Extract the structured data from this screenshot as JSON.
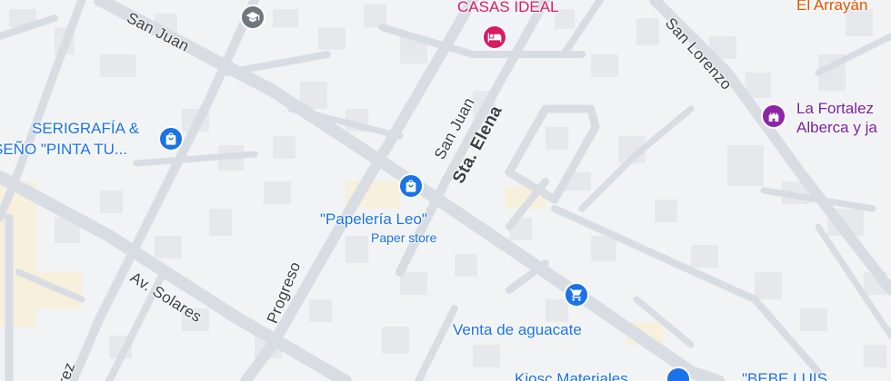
{
  "map": {
    "colors": {
      "background": "#f1f3f4",
      "road": "#d7dde3",
      "road_edge": "#c8d0d8",
      "building": "#e6e8eb",
      "sand": "#f7f0dc",
      "shopping": "#1a73e8",
      "lodging": "#d81b60",
      "landmark": "#7b1fa2",
      "education": "#5f6368"
    },
    "streets": [
      {
        "name": "San Juan"
      },
      {
        "name": "San Juan"
      },
      {
        "name": "Sta. Elena"
      },
      {
        "name": "San Lorenzo"
      },
      {
        "name": "Progreso"
      },
      {
        "name": "Av. Solares"
      },
      {
        "name": "rez"
      }
    ],
    "pois": {
      "casas_ideal": {
        "name": "CASAS IDEAL",
        "icon": "bed-icon"
      },
      "el_arrayan": {
        "name": "El Arrayán"
      },
      "fortaleza": {
        "name_line1": "La Fortalez",
        "name_line2": "Alberca y ja",
        "icon": "castle-icon"
      },
      "serigrafia": {
        "name_line1": "SERIGRAFÍA &",
        "name_line2": "SEÑO \"PINTA TU...",
        "icon": "shopping-bag-icon"
      },
      "papeleria": {
        "name": "\"Papelería Leo\"",
        "category": "Paper store",
        "icon": "shopping-bag-icon"
      },
      "aguacate": {
        "name": "Venta de aguacate",
        "icon": "shopping-cart-icon"
      },
      "kiosco": {
        "name": "Kiosc Materiales"
      },
      "bebe_luis": {
        "name": "\"BEBE LUIS"
      },
      "school": {
        "icon": "graduation-cap-icon"
      }
    }
  }
}
